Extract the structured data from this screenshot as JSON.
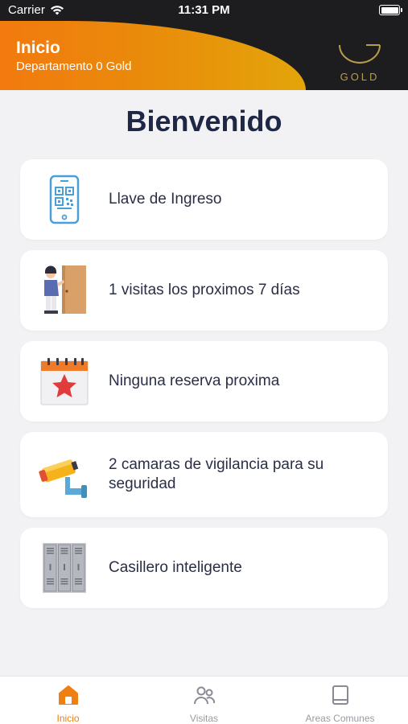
{
  "status_bar": {
    "carrier": "Carrier",
    "time": "11:31 PM"
  },
  "header": {
    "title": "Inicio",
    "subtitle": "Departamento 0 Gold",
    "brand": "GOLD"
  },
  "main": {
    "title": "Bienvenido",
    "cards": [
      {
        "label": "Llave de Ingreso",
        "icon": "qr-phone-icon"
      },
      {
        "label": "1 visitas los proximos 7 días",
        "icon": "visitor-door-icon"
      },
      {
        "label": "Ninguna reserva proxima",
        "icon": "calendar-star-icon"
      },
      {
        "label": "2 camaras de vigilancia para su seguridad",
        "icon": "security-camera-icon"
      },
      {
        "label": "Casillero inteligente",
        "icon": "lockers-icon"
      }
    ]
  },
  "tab_bar": {
    "tabs": [
      {
        "label": "Inicio",
        "active": true
      },
      {
        "label": "Visitas",
        "active": false
      },
      {
        "label": "Areas Comunes",
        "active": false
      }
    ]
  },
  "colors": {
    "accent": "#f07f12",
    "gold": "#b59e4a",
    "header_dark": "#1d1d1f",
    "title": "#1f2746"
  }
}
